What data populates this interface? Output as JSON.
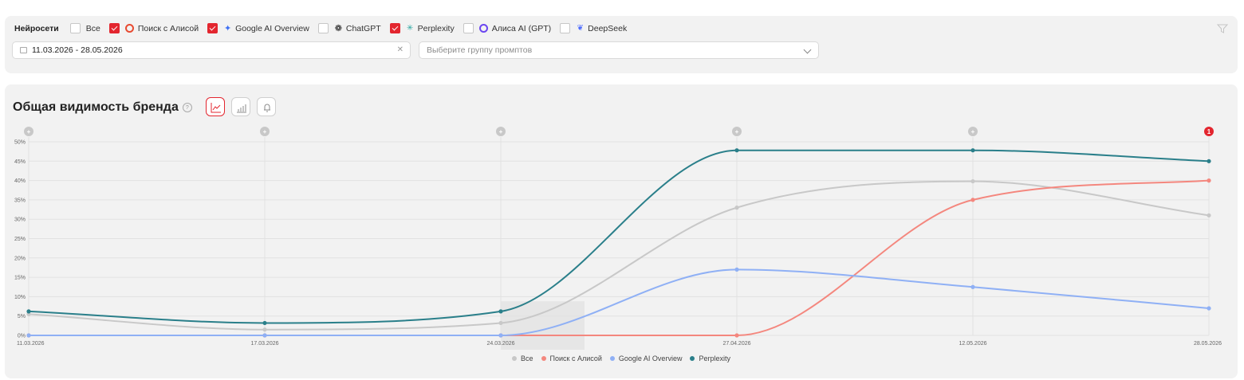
{
  "filters": {
    "title": "Нейросети",
    "options": [
      {
        "label": "Все",
        "checked": false,
        "icon": ""
      },
      {
        "label": "Поиск с Алисой",
        "checked": true,
        "icon": "alice-ring-icon"
      },
      {
        "label": "Google AI Overview",
        "checked": true,
        "icon": "gemini-star-icon"
      },
      {
        "label": "ChatGPT",
        "checked": false,
        "icon": "openai-icon"
      },
      {
        "label": "Perplexity",
        "checked": true,
        "icon": "perplexity-icon"
      },
      {
        "label": "Алиса AI (GPT)",
        "checked": false,
        "icon": "alice-ai-ring-icon"
      },
      {
        "label": "DeepSeek",
        "checked": false,
        "icon": "deepseek-whale-icon"
      }
    ],
    "date_range": "11.03.2026 - 28.05.2026",
    "group_placeholder": "Выберите группу промптов"
  },
  "chart_panel": {
    "title": "Общая видимость бренда",
    "help": "?",
    "event_badge": "1"
  },
  "chart_data": {
    "type": "line",
    "x": [
      "11.03.2026",
      "17.03.2026",
      "24.03.2026",
      "27.04.2026",
      "12.05.2026",
      "28.05.2026"
    ],
    "ylim": [
      0,
      50
    ],
    "yticks": [
      "0%",
      "5%",
      "10%",
      "15%",
      "20%",
      "25%",
      "30%",
      "35%",
      "40%",
      "45%",
      "50%"
    ],
    "grid": true,
    "legend_position": "bottom",
    "series": [
      {
        "name": "Все",
        "color": "#c8c8c8",
        "values": [
          5.5,
          1.5,
          3.2,
          33,
          39.8,
          31
        ]
      },
      {
        "name": "Поиск с Алисой",
        "color": "#f4877e",
        "values": [
          0,
          0,
          0,
          0,
          35,
          40
        ]
      },
      {
        "name": "Google AI Overview",
        "color": "#8fb0f5",
        "values": [
          0,
          0,
          0,
          17,
          12.5,
          7
        ]
      },
      {
        "name": "Perplexity",
        "color": "#2a7f8a",
        "values": [
          6.2,
          3.2,
          6.2,
          47.8,
          47.8,
          45
        ]
      }
    ]
  }
}
